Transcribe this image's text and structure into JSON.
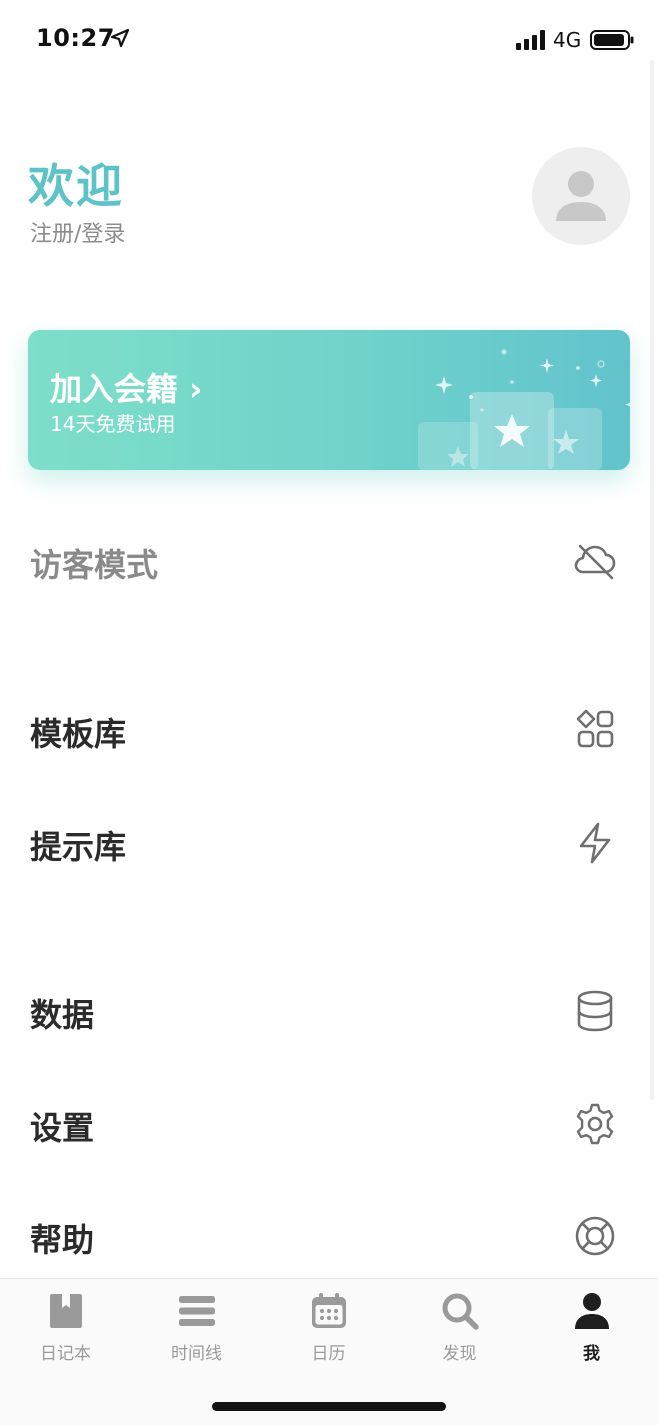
{
  "status_bar": {
    "time": "10:27",
    "network": "4G"
  },
  "header": {
    "title": "欢迎",
    "login": "注册/登录"
  },
  "banner": {
    "title": "加入会籍 ›",
    "subtitle": "14天免费试用"
  },
  "menu": {
    "guest": {
      "label": "访客模式",
      "icon": "cloud-off-icon"
    },
    "templates": {
      "label": "模板库",
      "icon": "grid-icon"
    },
    "prompts": {
      "label": "提示库",
      "icon": "lightning-icon"
    },
    "data": {
      "label": "数据",
      "icon": "database-icon"
    },
    "settings": {
      "label": "设置",
      "icon": "gear-icon"
    },
    "help": {
      "label": "帮助",
      "icon": "lifebuoy-icon"
    }
  },
  "tabs": [
    {
      "label": "日记本",
      "icon": "journal-icon"
    },
    {
      "label": "时间线",
      "icon": "timeline-icon"
    },
    {
      "label": "日历",
      "icon": "calendar-icon"
    },
    {
      "label": "发现",
      "icon": "search-icon"
    },
    {
      "label": "我",
      "icon": "person-icon",
      "active": true
    }
  ],
  "colors": {
    "accent": "#5ec3c6",
    "banner_start": "#7ddfc8",
    "banner_end": "#62c3cc",
    "icon": "#6f6f6f",
    "tab_inactive": "#9a9a9a"
  }
}
